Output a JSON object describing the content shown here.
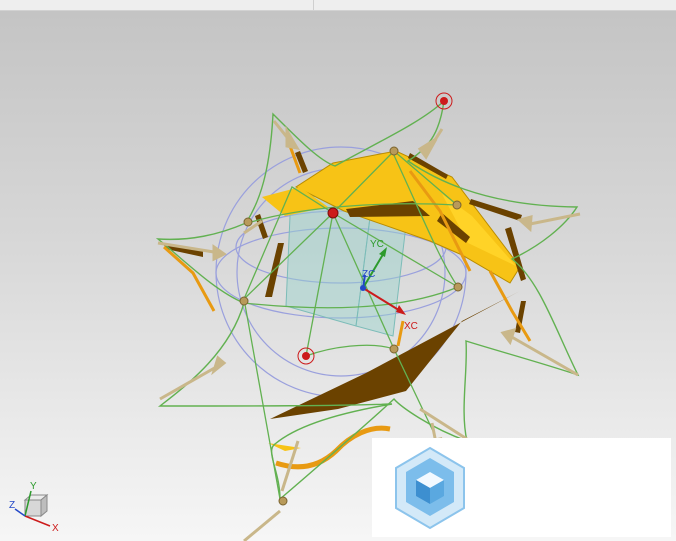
{
  "window": {
    "title": ""
  },
  "viewport": {
    "background_top": "#c4c4c4",
    "background_bottom": "#f6f6f6"
  },
  "model": {
    "wire_color": "#62b151",
    "surface_color": "#f7c316",
    "surface_dark_color": "#6b4200",
    "arrow_color": "#c9b78a",
    "sphere_color": "#9aa0dd",
    "point_color": "#cc1b1b",
    "csys_labels": {
      "x": "XC",
      "y": "YC",
      "z": "ZC"
    }
  },
  "triad": {
    "labels": {
      "x": "X",
      "y": "Y",
      "z": "Z"
    }
  },
  "watermark": {
    "text": "",
    "icon": "cube-hexagon-logo-icon",
    "icon_color": "#5aa8e0"
  }
}
